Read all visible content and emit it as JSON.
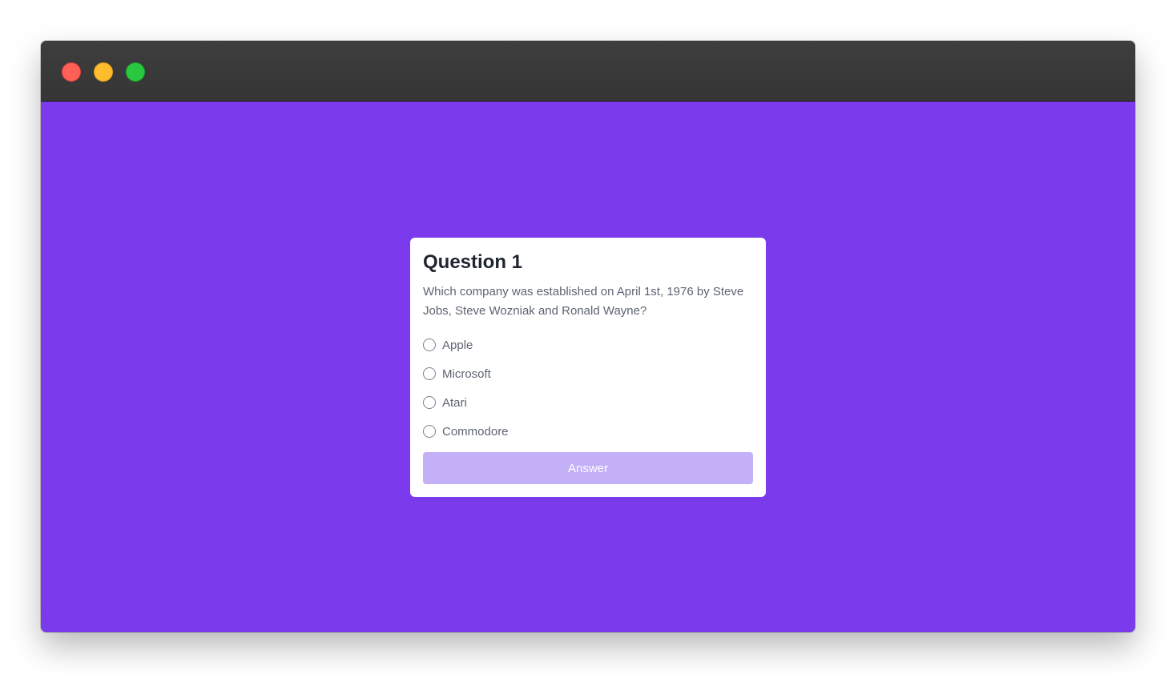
{
  "colors": {
    "background": "#7c3aed",
    "button_disabled": "#c4b0f7",
    "card": "#ffffff",
    "titlebar": "#3a3a3a"
  },
  "window": {
    "controls": [
      "close",
      "minimize",
      "zoom"
    ]
  },
  "quiz": {
    "title": "Question 1",
    "question": "Which company was established on April 1st, 1976 by Steve Jobs, Steve Wozniak and Ronald Wayne?",
    "options": [
      {
        "label": "Apple",
        "selected": false
      },
      {
        "label": "Microsoft",
        "selected": false
      },
      {
        "label": "Atari",
        "selected": false
      },
      {
        "label": "Commodore",
        "selected": false
      }
    ],
    "answer_button": "Answer"
  }
}
